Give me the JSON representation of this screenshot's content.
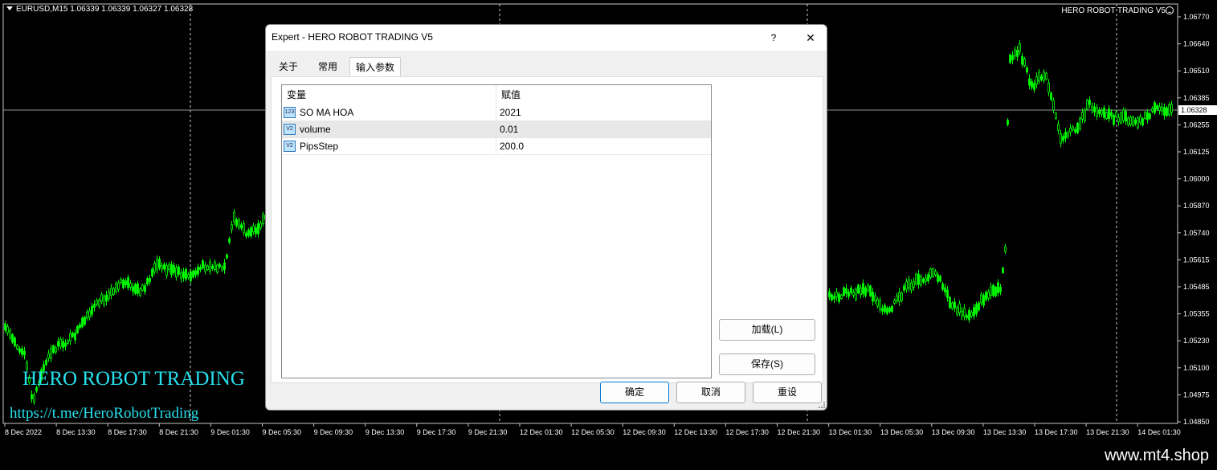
{
  "chart": {
    "symbol_info": "EURUSD,M15  1.06339 1.06339 1.06327 1.06328",
    "ea_name": "HERO ROBOT TRADING V5",
    "smile_icon": "smile-icon",
    "current_price": "1.06328",
    "price_axis": [
      "1.06770",
      "1.06640",
      "1.06510",
      "1.06385",
      "1.06255",
      "1.06125",
      "1.06000",
      "1.05870",
      "1.05740",
      "1.05615",
      "1.05485",
      "1.05355",
      "1.05230",
      "1.05100",
      "1.04975",
      "1.04850"
    ],
    "time_axis": [
      "8 Dec 2022",
      "8 Dec 13:30",
      "8 Dec 17:30",
      "8 Dec 21:30",
      "9 Dec 01:30",
      "9 Dec 05:30",
      "9 Dec 09:30",
      "9 Dec 13:30",
      "9 Dec 17:30",
      "9 Dec 21:30",
      "12 Dec 01:30",
      "12 Dec 05:30",
      "12 Dec 09:30",
      "12 Dec 13:30",
      "12 Dec 17:30",
      "12 Dec 21:30",
      "13 Dec 01:30",
      "13 Dec 05:30",
      "13 Dec 09:30",
      "13 Dec 13:30",
      "13 Dec 17:30",
      "13 Dec 21:30",
      "14 Dec 01:30"
    ],
    "candle_color": "#00ff00",
    "watermark": "HERO ROBOT TRADING",
    "telegram": "https://t.me/HeroRobotTrading"
  },
  "site": "www.mt4.shop",
  "dialog": {
    "title": "Expert - HERO ROBOT TRADING V5",
    "help": "?",
    "close_icon": "close-icon",
    "tabs": [
      {
        "label": "关于"
      },
      {
        "label": "常用"
      },
      {
        "label": "输入参数",
        "active": true
      }
    ],
    "table": {
      "headers": [
        "变量",
        "赋值"
      ],
      "rows": [
        {
          "icon": "int-param-icon",
          "icon_text": "123",
          "name": "SO MA HOA",
          "value": "2021"
        },
        {
          "icon": "double-param-icon",
          "icon_text": "V2",
          "name": "volume",
          "value": "0.01"
        },
        {
          "icon": "double-param-icon",
          "icon_text": "V2",
          "name": "PipsStep",
          "value": "200.0"
        }
      ]
    },
    "buttons": {
      "load": "加载(L)",
      "save": "保存(S)",
      "ok": "确定",
      "cancel": "取消",
      "reset": "重设"
    }
  }
}
